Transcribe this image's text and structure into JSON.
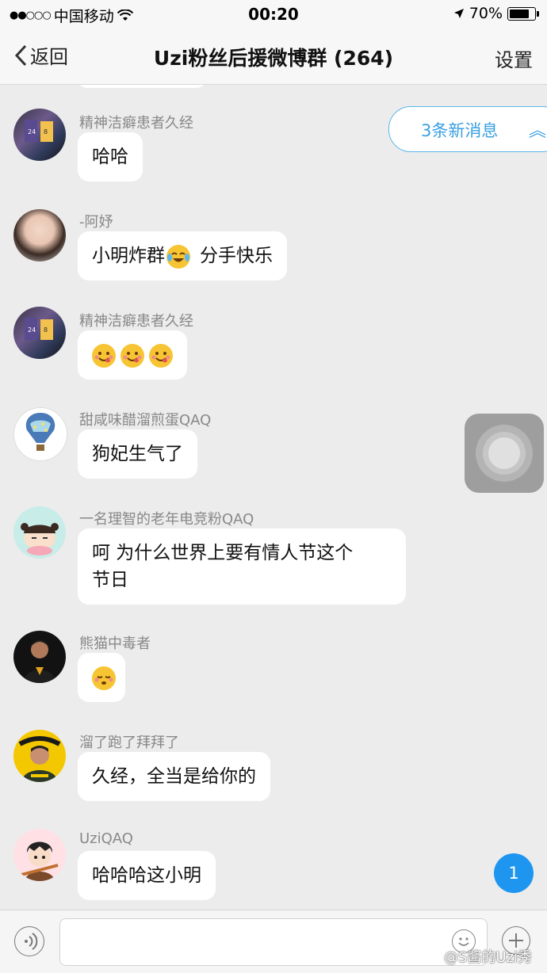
{
  "status": {
    "carrier": "中国移动",
    "time": "00:20",
    "battery": "70%"
  },
  "nav": {
    "back": "返回",
    "title": "Uzi粉丝后援微博群 (264)",
    "settings": "设置"
  },
  "new_messages": "3条新消息",
  "unread_count": "1",
  "messages": [
    {
      "name": "精神洁癖患者久经",
      "text": "哈哈"
    },
    {
      "name": "-阿妤",
      "text_before": "小明炸群",
      "text_after": "分手快乐"
    },
    {
      "name": "精神洁癖患者久经",
      "text": ""
    },
    {
      "name": "甜咸味醋溜煎蛋QAQ",
      "text": "狗妃生气了"
    },
    {
      "name": "一名理智的老年电竞粉QAQ",
      "line1": "呵 为什么世界上要有情人节这个",
      "line2": "节日"
    },
    {
      "name": "熊猫中毒者",
      "text": ""
    },
    {
      "name": "溜了跑了拜拜了",
      "text": "久经，全当是给你的"
    },
    {
      "name": "UziQAQ",
      "text": "哈哈哈这小明"
    }
  ],
  "watermark": "@S酱的Uzi秀",
  "colors": {
    "accent": "#1e96f0",
    "background": "#ececec",
    "bubble": "#ffffff"
  }
}
